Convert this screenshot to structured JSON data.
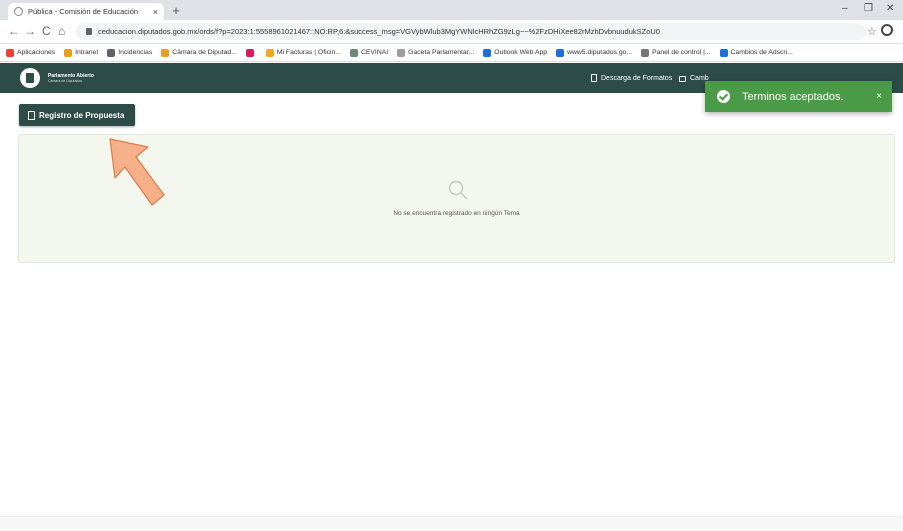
{
  "browser": {
    "tab_title": "Pública - Comisión de Educación",
    "tab_close": "×",
    "new_tab": "+",
    "window_controls": [
      "–",
      "❐",
      "✕"
    ],
    "nav": {
      "back": "←",
      "forward": "→",
      "reload": "C",
      "home": "⌂"
    },
    "url": "ceducacion.diputados.gob.mx/ords/f?p=2023:1:5558961021467::NO:RP,6:&success_msg=VGVybWlub3MgYWNlcHRhZG9zLg~~%2FzDHiXee82rMzhDvbnuudukSZoU0",
    "bookmarks": [
      {
        "label": "Aplicaciones",
        "color": "#ea4335"
      },
      {
        "label": "Intranet",
        "color": "#e8a020"
      },
      {
        "label": "Incidencias",
        "color": "#5f6368"
      },
      {
        "label": "Cámara de Diputad...",
        "color": "#e8a020"
      },
      {
        "label": "",
        "color": "#d81b60"
      },
      {
        "label": "Mi Facturas | Oficin...",
        "color": "#f6a623"
      },
      {
        "label": "CEVINAI",
        "color": "#6d8b74"
      },
      {
        "label": "Gaceta Parlamentar...",
        "color": "#9e9e9e"
      },
      {
        "label": "Outlook Web App",
        "color": "#1e6fd9"
      },
      {
        "label": "www5.diputados.go...",
        "color": "#1e6fd9"
      },
      {
        "label": "Panel de control |...",
        "color": "#757575"
      },
      {
        "label": "Cambios de Adscri...",
        "color": "#1e6fd9"
      }
    ]
  },
  "site_header": {
    "logo_title": "Parlamento Abierto",
    "logo_subtitle": "Cámara de Diputados",
    "links": [
      "Descarga de Formatos",
      "Camb"
    ]
  },
  "page": {
    "register_button": "Registro de Propuesta",
    "empty_message": "No se encuentra registrado en ningún Tema"
  },
  "toast": {
    "message": "Terminos aceptados.",
    "close": "×"
  },
  "colors": {
    "header_bg": "#2e4c47",
    "toast_bg": "#4a9a47",
    "panel_bg": "#f3f7ee",
    "arrow_fill": "#f5b08a",
    "arrow_stroke": "#e07a48"
  }
}
